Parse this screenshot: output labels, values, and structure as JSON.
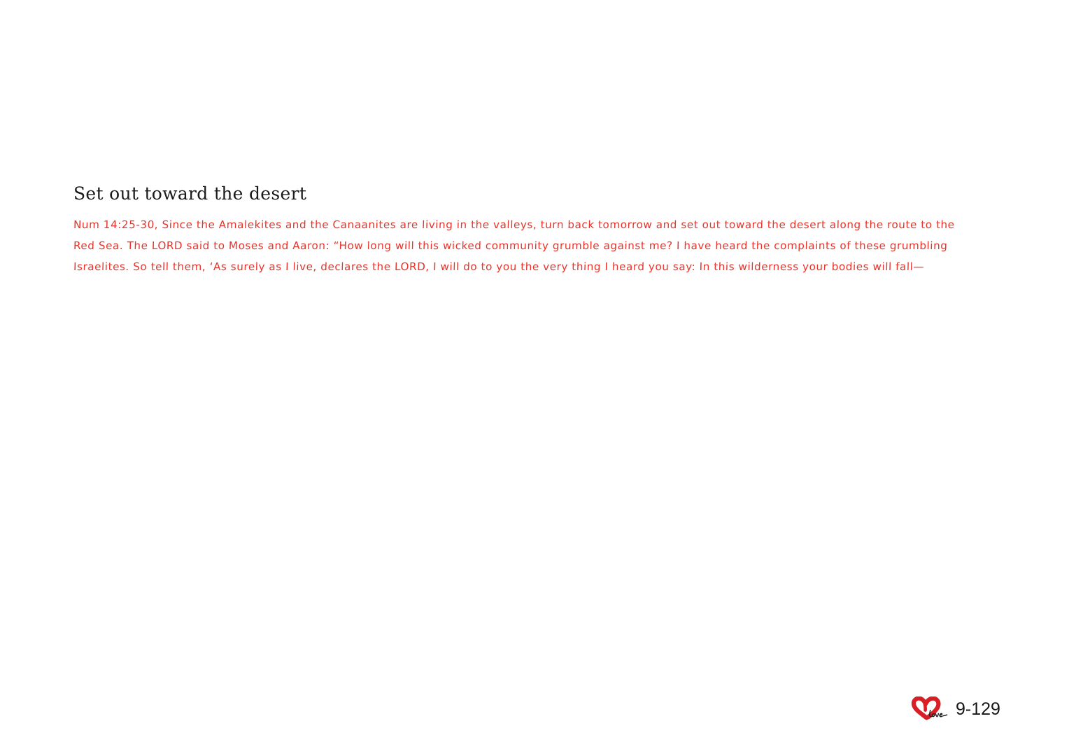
{
  "document": {
    "background_color": "#ffffff",
    "title": "Set out toward the desert",
    "title_color": "#1a1a1a"
  },
  "scripture": {
    "color": "#e8332a",
    "reference": "Num 14:25-30",
    "lines": [
      "Num 14:25-30, Since the Amalekites and the Canaanites are living in the valleys, turn back tomorrow and set out toward the desert along the route to the",
      "Red Sea. The LORD said to Moses and Aaron:  “How long will this wicked community grumble against me? I have heard the complaints of these grumbling",
      "Israelites.  So tell them, ‘As surely as I live, declares the LORD, I will do to you the very thing I heard you say:  In this wilderness your bodies will fall—"
    ],
    "full_text": "Num 14:25-30, Since the Amalekites and the Canaanites are living in the valleys, turn back tomorrow and set out toward the desert along the route to the Red Sea. The LORD said to Moses and Aaron:  “How long will this wicked community grumble against me? I have heard the complaints of these grumbling Israelites.  So tell them, ‘As surely as I live, declares the LORD, I will do to you the very thing I heard you say:  In this wilderness your bodies will fall—"
  },
  "footer": {
    "logo": {
      "icon": "heart-icon",
      "wordmark": "Love",
      "heart_color": "#d81f26",
      "wordmark_color": "#231f20"
    },
    "page_number": "9-129"
  }
}
